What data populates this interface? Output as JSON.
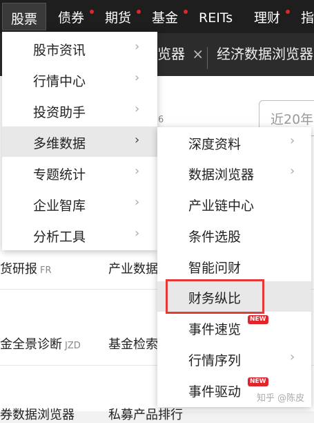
{
  "topnav": {
    "items": [
      {
        "label": "股票",
        "has_dot": false
      },
      {
        "label": "债券",
        "has_dot": true
      },
      {
        "label": "期货",
        "has_dot": true
      },
      {
        "label": "基金",
        "has_dot": true
      },
      {
        "label": "REITs",
        "has_dot": false
      },
      {
        "label": "理财",
        "has_dot": true
      },
      {
        "label": "指",
        "has_dot": false
      }
    ],
    "dot_color": "#e0262b"
  },
  "tabs": {
    "tab1_partial": "览器",
    "tab1_close": "×",
    "tab2": "经济数据浏览器"
  },
  "background": {
    "search_placeholder": "近20年",
    "partial_digit": "6",
    "row1_left": "货研报",
    "row1_left_sub": "FR",
    "row1_right": "产业数据",
    "row2_left": "金全景诊断",
    "row2_left_sub": "JZD",
    "row2_right": "基金检索",
    "row3_left": "券数据浏览器",
    "row3_right": "私募产品排行"
  },
  "menu1": {
    "items": [
      {
        "label": "股市资讯"
      },
      {
        "label": "行情中心"
      },
      {
        "label": "投资助手"
      },
      {
        "label": "多维数据"
      },
      {
        "label": "专题统计"
      },
      {
        "label": "企业智库"
      },
      {
        "label": "分析工具"
      }
    ],
    "hovered_index": 3
  },
  "menu2": {
    "items": [
      {
        "label": "深度资料",
        "chevron": true
      },
      {
        "label": "数据浏览器",
        "chevron": true
      },
      {
        "label": "产业链中心",
        "chevron": false
      },
      {
        "label": "条件选股",
        "chevron": false
      },
      {
        "label": "智能问财",
        "chevron": false
      },
      {
        "label": "财务纵比",
        "chevron": false
      },
      {
        "label": "事件速览",
        "chevron": false,
        "badge": "NEW"
      },
      {
        "label": "行情序列",
        "chevron": true
      },
      {
        "label": "事件驱动",
        "chevron": false,
        "badge": "NEW"
      }
    ],
    "hovered_index": 5
  },
  "icons": {
    "chevron": "›"
  },
  "watermark": "知乎 @陈皮",
  "colors": {
    "nav_bg": "#1e1e1e",
    "highlight_border": "#e53935",
    "badge_bg": "#e0262b",
    "hover_bg": "#e8e8e8"
  }
}
